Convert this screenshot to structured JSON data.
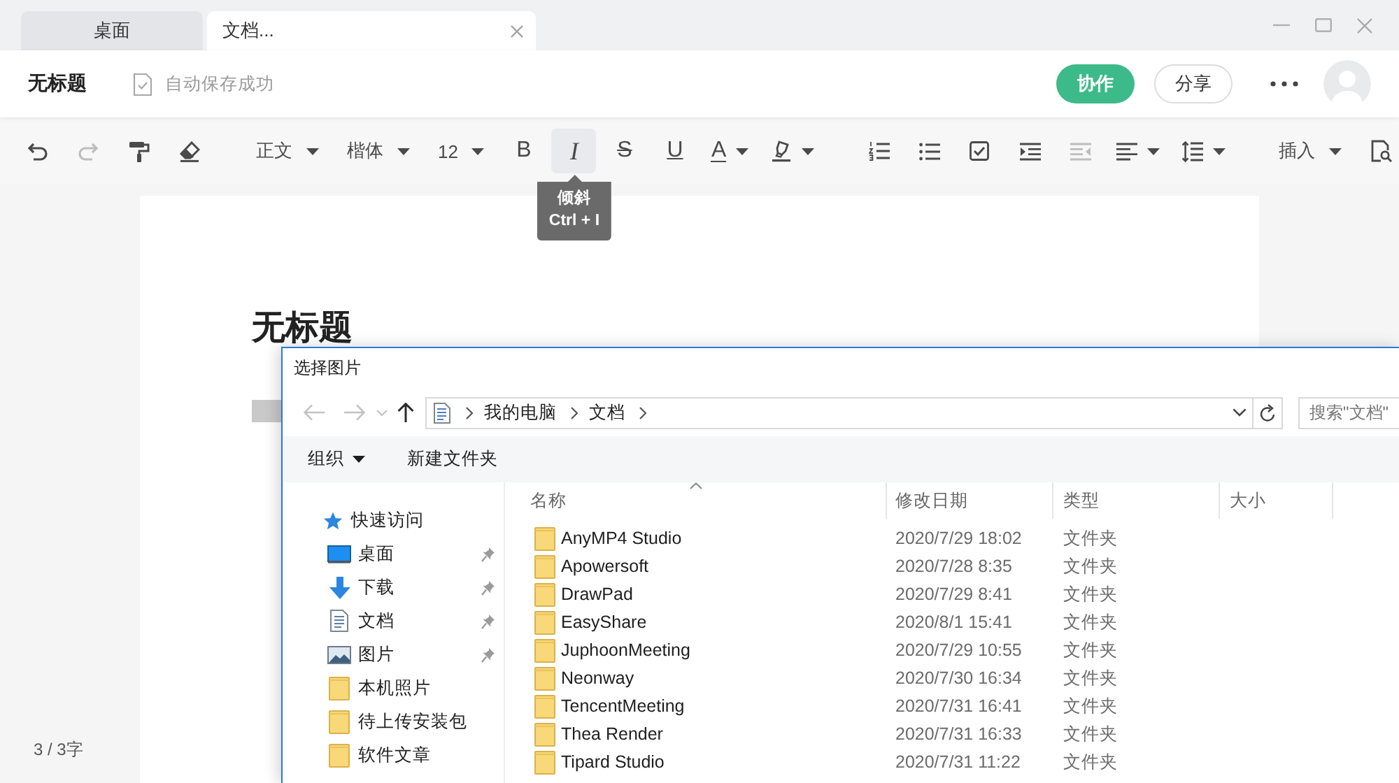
{
  "tabs": [
    {
      "label": "桌面",
      "selected": false
    },
    {
      "label": "文档...",
      "selected": true
    }
  ],
  "header": {
    "title": "无标题",
    "save_status": "自动保存成功",
    "buttons": [
      {
        "label": "协作",
        "kind": "primary"
      },
      {
        "label": "分享",
        "kind": "outline"
      }
    ]
  },
  "toolbar": {
    "groups": [
      {
        "items": [
          {
            "kind": "undo",
            "disabled": false,
            "hovered": false
          },
          {
            "kind": "redo",
            "disabled": true,
            "hovered": false
          },
          {
            "kind": "painter",
            "disabled": false,
            "hovered": false
          },
          {
            "kind": "eraser",
            "disabled": false,
            "hovered": false
          }
        ]
      },
      {
        "items": [
          {
            "kind": "menu",
            "label": "正文",
            "disabled": false,
            "hovered": false
          },
          {
            "kind": "menu",
            "label": "楷体",
            "disabled": false,
            "hovered": false
          },
          {
            "kind": "menu",
            "label": "12",
            "disabled": false,
            "hovered": false
          },
          {
            "kind": "bold",
            "label": "B",
            "disabled": false,
            "hovered": false
          },
          {
            "kind": "italic",
            "label": "I",
            "disabled": false,
            "hovered": true
          },
          {
            "kind": "strike",
            "label": "S",
            "disabled": false,
            "hovered": false
          },
          {
            "kind": "underline",
            "label": "U",
            "disabled": false,
            "hovered": false
          },
          {
            "kind": "fontcolor",
            "label": "A",
            "disabled": false,
            "hovered": false
          },
          {
            "kind": "highlight",
            "disabled": false,
            "hovered": false
          }
        ]
      },
      {
        "items": [
          {
            "kind": "ordered",
            "disabled": false,
            "hovered": false
          },
          {
            "kind": "bullets",
            "disabled": false,
            "hovered": false
          },
          {
            "kind": "checklist",
            "disabled": false,
            "hovered": false
          },
          {
            "kind": "indent",
            "disabled": false,
            "hovered": false
          },
          {
            "kind": "outdent",
            "disabled": true,
            "hovered": false
          },
          {
            "kind": "align",
            "disabled": false,
            "hovered": false
          },
          {
            "kind": "spacing",
            "disabled": false,
            "hovered": false
          }
        ]
      },
      {
        "items": [
          {
            "kind": "menu",
            "label": "插入",
            "disabled": false,
            "hovered": false
          },
          {
            "kind": "find",
            "disabled": false,
            "hovered": false
          }
        ]
      }
    ],
    "tooltip": {
      "lines": [
        "倾斜",
        "Ctrl + I"
      ]
    }
  },
  "editor": {
    "heading": "无标题",
    "word_count": "3 / 3字"
  },
  "dialog": {
    "title": "选择图片",
    "nav": [
      {
        "kind": "back",
        "disabled": true
      },
      {
        "kind": "forward",
        "disabled": true
      },
      {
        "kind": "recent",
        "disabled": true
      },
      {
        "kind": "up",
        "disabled": false
      }
    ],
    "path": [
      "我的电脑",
      "文档"
    ],
    "search": {
      "placeholder": "搜索\"文档\""
    },
    "commands": [
      {
        "label": "组织",
        "dropdown": true
      },
      {
        "label": "新建文件夹",
        "dropdown": false
      }
    ],
    "sidebar": [
      {
        "label": "快速访问",
        "kind": "quickaccess",
        "pinned": false,
        "children": [
          {
            "label": "桌面",
            "kind": "desktop",
            "pinned": true
          },
          {
            "label": "下载",
            "kind": "downloads",
            "pinned": true
          },
          {
            "label": "文档",
            "kind": "documents",
            "pinned": true
          },
          {
            "label": "图片",
            "kind": "pictures",
            "pinned": true
          },
          {
            "label": "本机照片",
            "kind": "folder",
            "pinned": false
          },
          {
            "label": "待上传安装包",
            "kind": "folder",
            "pinned": false
          },
          {
            "label": "软件文章",
            "kind": "folder",
            "pinned": false
          }
        ]
      }
    ],
    "columns": [
      {
        "label": "名称",
        "sorted": true
      },
      {
        "label": "修改日期",
        "sorted": false
      },
      {
        "label": "类型",
        "sorted": false
      },
      {
        "label": "大小",
        "sorted": false
      }
    ],
    "rows": [
      {
        "name": "AnyMP4 Studio",
        "modified": "2020/7/29 18:02",
        "type": "文件夹"
      },
      {
        "name": "Apowersoft",
        "modified": "2020/7/28 8:35",
        "type": "文件夹"
      },
      {
        "name": "DrawPad",
        "modified": "2020/7/29 8:41",
        "type": "文件夹"
      },
      {
        "name": "EasyShare",
        "modified": "2020/8/1 15:41",
        "type": "文件夹"
      },
      {
        "name": "JuphoonMeeting",
        "modified": "2020/7/29 10:55",
        "type": "文件夹"
      },
      {
        "name": "Neonway",
        "modified": "2020/7/30 16:34",
        "type": "文件夹"
      },
      {
        "name": "TencentMeeting",
        "modified": "2020/7/31 16:41",
        "type": "文件夹"
      },
      {
        "name": "Thea Render",
        "modified": "2020/7/31 16:33",
        "type": "文件夹"
      },
      {
        "name": "Tipard Studio",
        "modified": "2020/7/31 11:22",
        "type": "文件夹"
      }
    ]
  }
}
